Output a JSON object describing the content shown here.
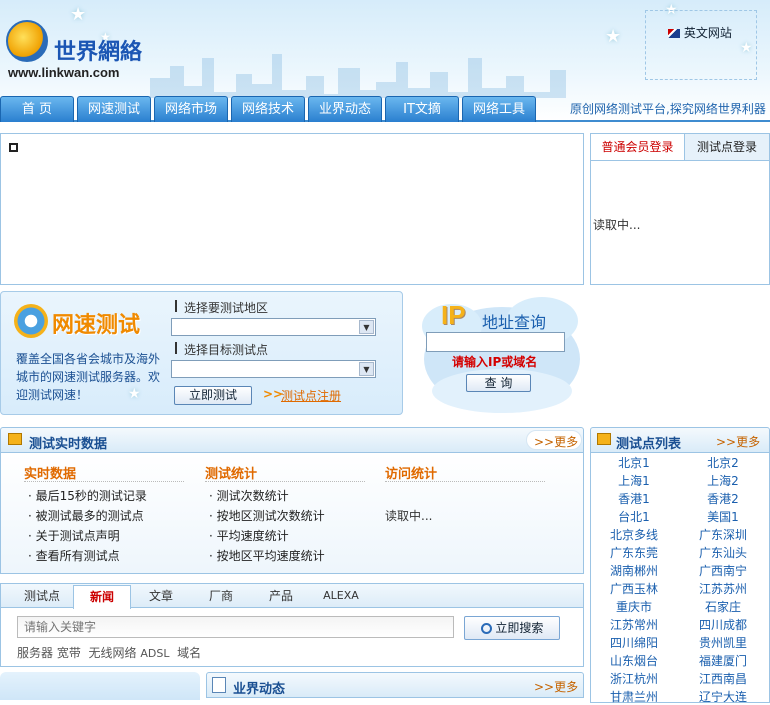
{
  "header": {
    "logo_cn": "世界網絡",
    "logo_url": "www.linkwan.com",
    "english_site": "英文网站",
    "slogan": "原创网络测试平台,探究网络世界利器"
  },
  "nav": [
    "首 页",
    "网速测试",
    "网络市场",
    "网络技术",
    "业界动态",
    "IT文摘",
    "网络工具"
  ],
  "login": {
    "tabs": [
      "普通会员登录",
      "测试点登录"
    ],
    "loading": "读取中..."
  },
  "speed_test": {
    "title": "网速测试",
    "desc": "覆盖全国各省会城市及海外城市的网速测试服务器。欢迎测试网速！",
    "region_label": "选择要测试地区",
    "target_label": "选择目标测试点",
    "test_button": "立即测试",
    "register_link": "测试点注册"
  },
  "ip_query": {
    "title_ip": "IP",
    "title_rest": "地址查询",
    "hint": "请输入IP或域名",
    "button": "查 询"
  },
  "realtime": {
    "title": "测试实时数据",
    "more": ">>更多",
    "col1": {
      "head": "实时数据",
      "items": [
        "最后15秒的测试记录",
        "被测试最多的测试点",
        "关于测试点声明",
        "查看所有测试点"
      ]
    },
    "col2": {
      "head": "测试统计",
      "items": [
        "测试次数统计",
        "按地区测试次数统计",
        "平均速度统计",
        "按地区平均速度统计"
      ]
    },
    "col3": {
      "head": "访问统计",
      "loading": "读取中..."
    }
  },
  "points": {
    "title": "测试点列表",
    "more": ">>更多",
    "items": [
      "北京1",
      "北京2",
      "上海1",
      "上海2",
      "香港1",
      "香港2",
      "台北1",
      "美国1",
      "北京多线",
      "广东深圳",
      "广东东莞",
      "广东汕头",
      "湖南郴州",
      "广西南宁",
      "广西玉林",
      "江苏苏州",
      "重庆市",
      "石家庄",
      "江苏常州",
      "四川成都",
      "四川绵阳",
      "贵州凯里",
      "山东烟台",
      "福建厦门",
      "浙江杭州",
      "江西南昌",
      "甘肃兰州",
      "辽宁大连"
    ]
  },
  "search": {
    "tabs": [
      "测试点",
      "新闻",
      "文章",
      "厂商",
      "产品",
      "ALEXA"
    ],
    "placeholder": "请输入关键字",
    "button": "立即搜索",
    "hot": [
      "服务器",
      "宽带",
      "无线网络",
      "ADSL",
      "域名"
    ]
  },
  "industry": {
    "title": "业界动态",
    "more": ">>更多"
  }
}
